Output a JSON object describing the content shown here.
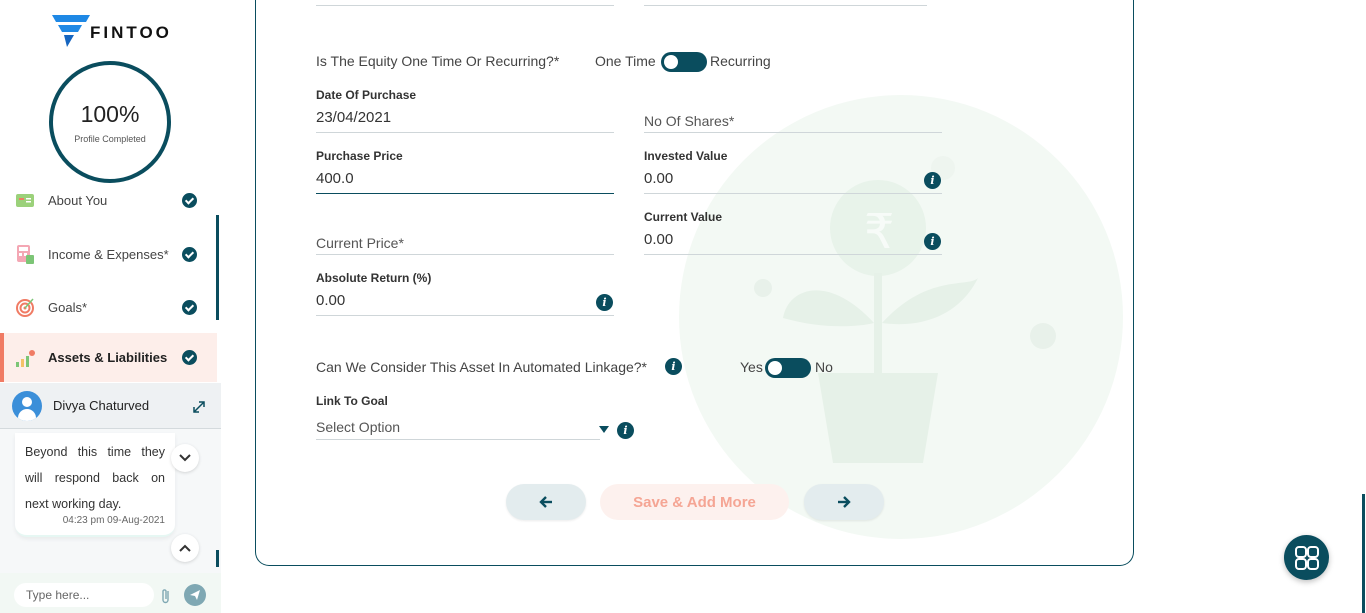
{
  "brand": {
    "name": "FINTOO",
    "accent": "#0a4d5e",
    "highlight": "#f07b64",
    "logo_blue": "#1e88e5"
  },
  "profile": {
    "percent": "100%",
    "label": "Profile Completed"
  },
  "sidebar": {
    "items": [
      {
        "label": "About You",
        "icon": "id-card-icon",
        "done": true
      },
      {
        "label": "Income & Expenses*",
        "icon": "calculator-icon",
        "done": true
      },
      {
        "label": "Goals*",
        "icon": "target-icon",
        "done": true
      },
      {
        "label": "Assets & Liabilities",
        "icon": "growth-plant-icon",
        "done": true,
        "active": true
      }
    ]
  },
  "chat": {
    "agent_name": "Divya Chaturved",
    "message": "Beyond this time they will respond back on next working day.",
    "timestamp": "04:23 pm 09-Aug-2021",
    "input_placeholder": "Type here..."
  },
  "form": {
    "equity_type": {
      "question": "Is The Equity One Time Or Recurring?*",
      "left": "One Time",
      "right": "Recurring",
      "selected": "One Time"
    },
    "date_of_purchase": {
      "label": "Date Of Purchase",
      "value": "23/04/2021"
    },
    "no_of_shares": {
      "placeholder": "No Of Shares*",
      "value": ""
    },
    "purchase_price": {
      "label": "Purchase Price",
      "value": "400.0"
    },
    "invested_value": {
      "label": "Invested Value",
      "value": "0.00"
    },
    "current_price": {
      "placeholder": "Current Price*",
      "value": ""
    },
    "current_value": {
      "label": "Current Value",
      "value": "0.00"
    },
    "absolute_return": {
      "label": "Absolute Return (%)",
      "value": "0.00"
    },
    "automated_linkage": {
      "question": "Can We Consider This Asset In Automated Linkage?*",
      "left": "Yes",
      "right": "No",
      "selected": "Yes"
    },
    "link_to_goal": {
      "label": "Link To Goal",
      "selected": "Select Option"
    }
  },
  "actions": {
    "save_add_more": "Save & Add More"
  }
}
